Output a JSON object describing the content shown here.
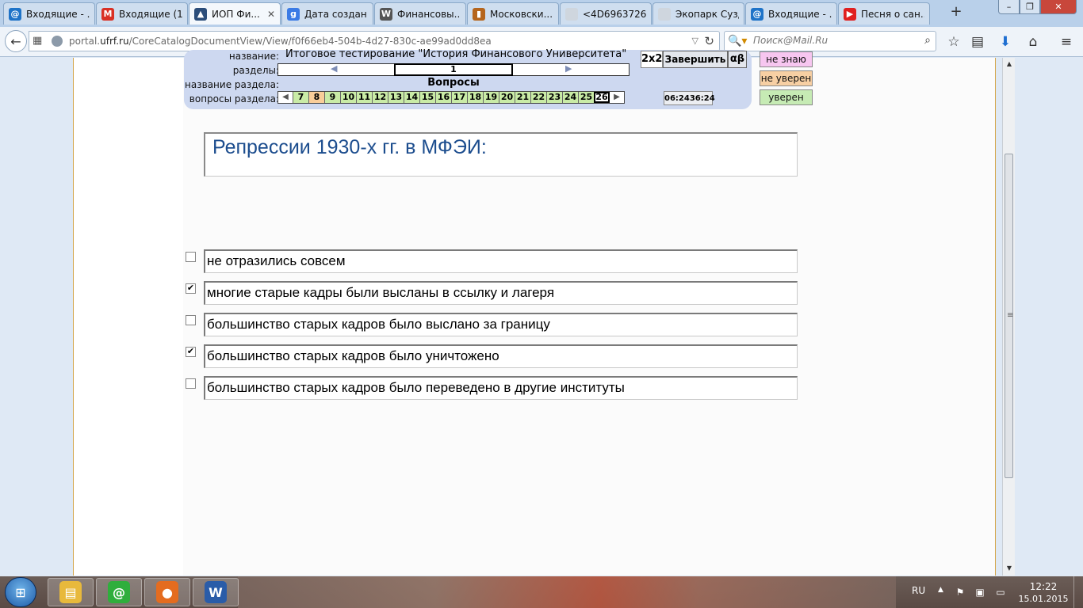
{
  "browser": {
    "tabs": [
      {
        "label": "Входящие - ...",
        "icon": "mail-ru-icon",
        "color": "#1e73c8",
        "glyph": "@",
        "active": false
      },
      {
        "label": "Входящие (1...",
        "icon": "gmail-icon",
        "color": "#d93025",
        "glyph": "M",
        "active": false
      },
      {
        "label": "ИОП Фи...",
        "icon": "university-icon",
        "color": "#2b4d7a",
        "glyph": "▲",
        "active": true
      },
      {
        "label": "Дата создан...",
        "icon": "google-icon",
        "color": "#3b7be5",
        "glyph": "g",
        "active": false
      },
      {
        "label": "Финансовы...",
        "icon": "wikipedia-icon",
        "color": "#555555",
        "glyph": "W",
        "active": false
      },
      {
        "label": "Московски...",
        "icon": "books-icon",
        "color": "#b5651d",
        "glyph": "▮",
        "active": false
      },
      {
        "label": "<4D6963726F736...",
        "icon": "blank-page-icon",
        "color": "#cfd6de",
        "glyph": "",
        "active": false
      },
      {
        "label": "Экопарк Суздал...",
        "icon": "blank-page-icon",
        "color": "#cfd6de",
        "glyph": "",
        "active": false
      },
      {
        "label": "Входящие - ...",
        "icon": "mail-ru-icon",
        "color": "#1e73c8",
        "glyph": "@",
        "active": false
      },
      {
        "label": "Песня о сан...",
        "icon": "youtube-icon",
        "color": "#e02020",
        "glyph": "▶",
        "active": false
      }
    ],
    "url_host": "portal.ufrf.ru",
    "url_path": "/CoreCatalogDocumentView/View/f0f66eb4-504b-4d27-830c-ae99ad0dd8ea",
    "url_prefix": "portal.",
    "url_domain": "ufrf.ru",
    "search_placeholder": "Поиск@Mail.Ru"
  },
  "test": {
    "labels": {
      "title": "название:",
      "sections": "разделы:",
      "section_name": "название раздела:",
      "section_questions": "вопросы раздела:"
    },
    "title": "Итоговое тестирование \"История Финансового Университета\"",
    "current_section": "1",
    "section_name": "Вопросы",
    "questions": [
      {
        "n": "7",
        "state": "green"
      },
      {
        "n": "8",
        "state": "orange"
      },
      {
        "n": "9",
        "state": "green"
      },
      {
        "n": "10",
        "state": "green"
      },
      {
        "n": "11",
        "state": "green"
      },
      {
        "n": "12",
        "state": "green"
      },
      {
        "n": "13",
        "state": "green"
      },
      {
        "n": "14",
        "state": "green"
      },
      {
        "n": "15",
        "state": "green"
      },
      {
        "n": "16",
        "state": "green"
      },
      {
        "n": "17",
        "state": "green"
      },
      {
        "n": "18",
        "state": "green"
      },
      {
        "n": "19",
        "state": "green"
      },
      {
        "n": "20",
        "state": "green"
      },
      {
        "n": "21",
        "state": "green"
      },
      {
        "n": "22",
        "state": "green"
      },
      {
        "n": "23",
        "state": "green"
      },
      {
        "n": "24",
        "state": "green"
      },
      {
        "n": "25",
        "state": "green"
      },
      {
        "n": "26",
        "state": "current"
      }
    ],
    "btn_2x2": "2x2",
    "btn_finish": "Завершить",
    "btn_alpha": "αβ",
    "timer_elapsed": "06:24",
    "timer_total": "36:24",
    "confidence": {
      "dont_know": "не знаю",
      "unsure": "не уверен",
      "sure": "уверен"
    },
    "question": "Репрессии 1930-х гг. в МФЭИ:",
    "answers": [
      {
        "text": "не отразились совсем",
        "checked": false
      },
      {
        "text": "многие старые кадры были высланы в ссылку и лагеря",
        "checked": true
      },
      {
        "text": "большинство старых кадров было выслано за границу",
        "checked": false
      },
      {
        "text": "большинство старых кадров было уничтожено",
        "checked": true
      },
      {
        "text": "большинство старых кадров было переведено в другие институты",
        "checked": false
      }
    ]
  },
  "taskbar": {
    "lang": "RU",
    "time": "12:22",
    "date": "15.01.2015",
    "apps": [
      {
        "icon": "file-explorer-icon",
        "color": "#e8b93c",
        "glyph": "▤"
      },
      {
        "icon": "mail-agent-icon",
        "color": "#2fae3c",
        "glyph": "@"
      },
      {
        "icon": "firefox-icon",
        "color": "#e46c1f",
        "glyph": "●"
      },
      {
        "icon": "word-icon",
        "color": "#2a5ca8",
        "glyph": "W"
      }
    ]
  }
}
